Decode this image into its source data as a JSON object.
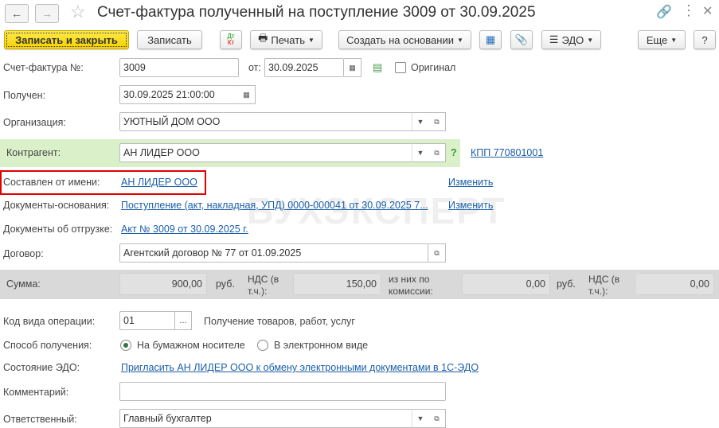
{
  "header": {
    "title": "Счет-фактура полученный на поступление 3009 от 30.09.2025"
  },
  "toolbar": {
    "save_close": "Записать и закрыть",
    "save": "Записать",
    "dtkt_top": "Дт",
    "dtkt_bottom": "Кт",
    "print": "Печать",
    "create_based": "Создать на основании",
    "edo": "ЭДО",
    "more": "Еще",
    "help": "?"
  },
  "form": {
    "invoice_label": "Счет-фактура №:",
    "invoice_no": "3009",
    "from_label": "от:",
    "invoice_date": "30.09.2025",
    "original_label": "Оригинал",
    "received_label": "Получен:",
    "received": "30.09.2025 21:00:00",
    "org_label": "Организация:",
    "org": "УЮТНЫЙ ДОМ ООО",
    "counterparty_label": "Контрагент:",
    "counterparty": "АН ЛИДЕР ООО",
    "kpp": "КПП 770801001",
    "q": "?",
    "on_behalf_label": "Составлен от имени:",
    "on_behalf": "АН ЛИДЕР ООО",
    "change": "Изменить",
    "base_docs_label": "Документы-основания:",
    "base_docs": "Поступление (акт, накладная, УПД) 0000-000041 от 30.09.2025 7...",
    "change2": "Изменить",
    "ship_docs_label": "Документы об отгрузке:",
    "ship_docs": "Акт № 3009 от 30.09.2025 г.",
    "contract_label": "Договор:",
    "contract": "Агентский договор № 77 от 01.09.2025",
    "sum_label": "Сумма:",
    "sum": "900,00",
    "rub": "руб.",
    "vat_label": "НДС (в т.ч.):",
    "vat": "150,00",
    "commission_label": "из них по комиссии:",
    "commission": "0,00",
    "rub2": "руб.",
    "vat2_label": "НДС (в т.ч.):",
    "vat2": "0,00",
    "op_code_label": "Код вида операции:",
    "op_code": "01",
    "op_code_btn": "...",
    "op_code_desc": "Получение товаров, работ, услуг",
    "method_label": "Способ получения:",
    "method_paper": "На бумажном носителе",
    "method_electronic": "В электронном виде",
    "method_selected": "paper",
    "edo_state_label": "Состояние ЭДО:",
    "edo_invite": "Пригласить АН ЛИДЕР ООО к обмену электронными документами в 1С-ЭДО",
    "comment_label": "Комментарий:",
    "comment": "",
    "responsible_label": "Ответственный:",
    "responsible": "Главный бухгалтер"
  },
  "watermark": "БУХЭКСПЕРТ",
  "colors": {
    "primary": "#f5d200",
    "highlight": "#d9f0c8",
    "link": "#1a5ea8",
    "sum_bg": "#d9d9d9",
    "marker": "#e00000"
  }
}
